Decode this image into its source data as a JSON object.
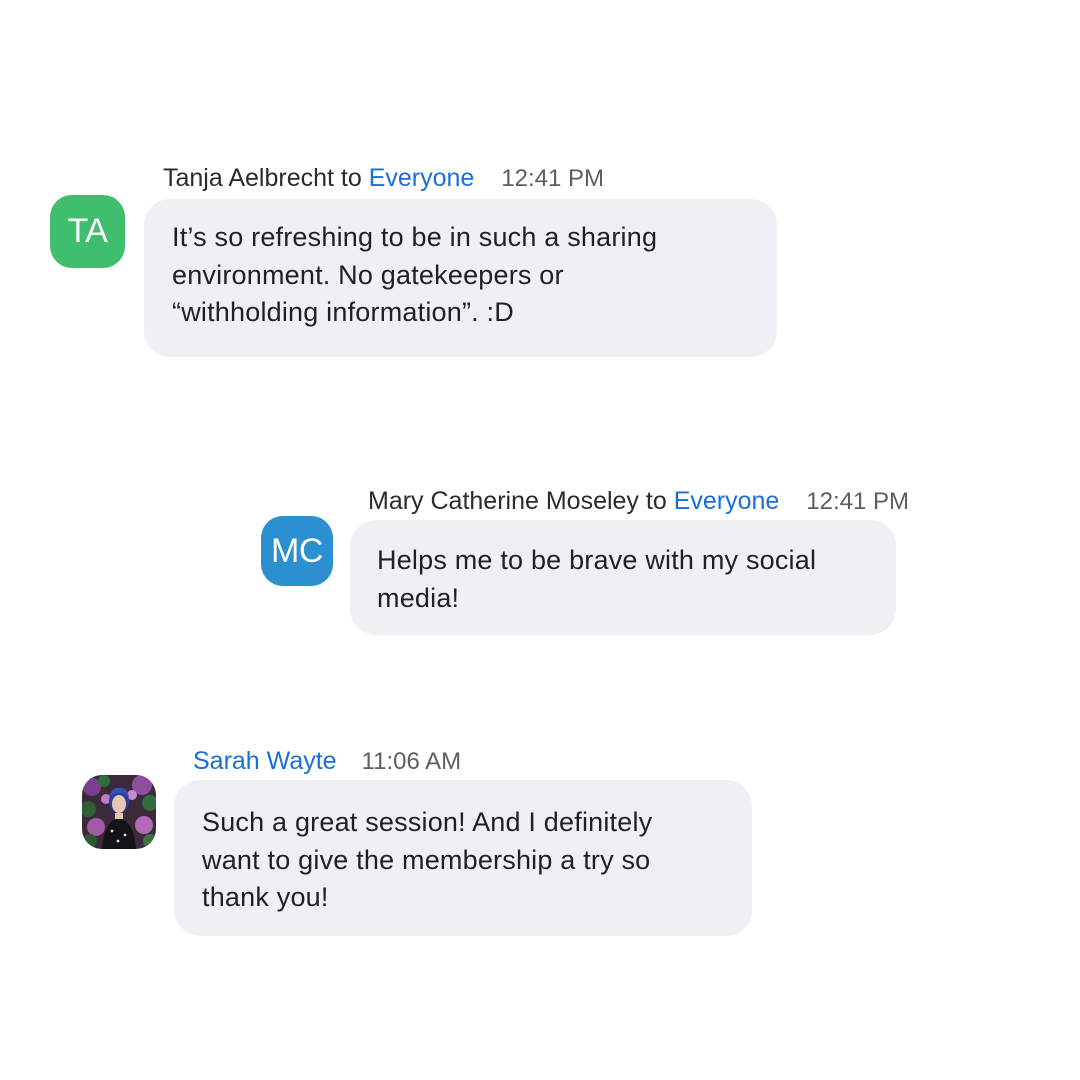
{
  "messages": [
    {
      "sender": "Tanja Aelbrecht",
      "to_word": "to",
      "recipient": "Everyone",
      "time": "12:41 PM",
      "avatar_initials": "TA",
      "avatar_color": "#3fbf6d",
      "text": "It’s so refreshing to be in such a sharing\nenvironment. No gatekeepers or\n“withholding information”. :D"
    },
    {
      "sender": "Mary Catherine Moseley",
      "to_word": "to",
      "recipient": "Everyone",
      "time": "12:41 PM",
      "avatar_initials": "MC",
      "avatar_color": "#2b8fd0",
      "text": "Helps me to be brave with my social\nmedia!"
    },
    {
      "sender": "Sarah Wayte",
      "time": "11:06 AM",
      "avatar_icon": "profile-photo",
      "text": "Such a great session! And I definitely\nwant to give the membership a try so\nthank you!"
    }
  ],
  "colors": {
    "link": "#1a6fd6",
    "bubble": "#f0f0f4",
    "text": "#1f1f24",
    "time": "#5e5e5e"
  }
}
